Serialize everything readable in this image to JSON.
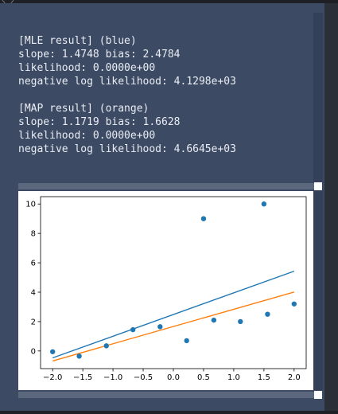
{
  "topbar": {
    "glyph": "⸜ ⸝"
  },
  "output": {
    "lines": [
      "[MLE result] (blue)",
      "slope: 1.4748 bias: 2.4784",
      "likelihood: 0.0000e+00",
      "negative log likelihood: 4.1298e+03",
      "",
      "[MAP result] (orange)",
      "slope: 1.1719 bias: 1.6628",
      "likelihood: 0.0000e+00",
      "negative log likelihood: 4.6645e+03"
    ]
  },
  "chart_data": {
    "type": "scatter",
    "xlim": [
      -2.2,
      2.2
    ],
    "ylim": [
      -1.2,
      10.5
    ],
    "xticks": [
      -2.0,
      -1.5,
      -1.0,
      -0.5,
      0.0,
      0.5,
      1.0,
      1.5,
      2.0
    ],
    "xtick_labels": [
      "−2.0",
      "−1.5",
      "−1.0",
      "−0.5",
      "0.0",
      "0.5",
      "1.0",
      "1.5",
      "2.0"
    ],
    "yticks": [
      0,
      2,
      4,
      6,
      8,
      10
    ],
    "ytick_labels": [
      "0",
      "2",
      "4",
      "6",
      "8",
      "10"
    ],
    "grid": false,
    "points": {
      "x": [
        -2.0,
        -1.56,
        -1.11,
        -0.67,
        -0.22,
        0.22,
        0.67,
        1.11,
        1.56,
        2.0,
        0.5,
        1.5
      ],
      "y": [
        -0.05,
        -0.35,
        0.35,
        1.45,
        1.65,
        0.7,
        2.1,
        2.0,
        2.5,
        3.2,
        9.0,
        10.0
      ],
      "color": "#1f77b4"
    },
    "lines": [
      {
        "label": "MLE",
        "color": "#1f77b4",
        "x": [
          -2.0,
          2.0
        ],
        "y": [
          -0.47,
          5.43
        ]
      },
      {
        "label": "MAP",
        "color": "#ff7f0e",
        "x": [
          -2.0,
          2.0
        ],
        "y": [
          -0.68,
          4.01
        ]
      }
    ]
  }
}
